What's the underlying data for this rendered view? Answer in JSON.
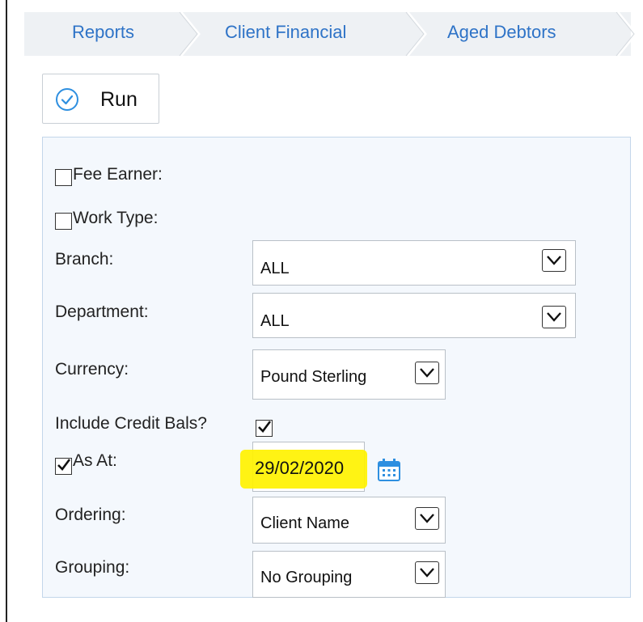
{
  "breadcrumb": {
    "items": [
      "Reports",
      "Client Financial",
      "Aged Debtors"
    ]
  },
  "toolbar": {
    "run_label": "Run"
  },
  "form": {
    "fee_earner": {
      "label": "Fee Earner:",
      "checked": false
    },
    "work_type": {
      "label": "Work Type:",
      "checked": false
    },
    "branch": {
      "label": "Branch:",
      "value": "ALL"
    },
    "department": {
      "label": "Department:",
      "value": "ALL"
    },
    "currency": {
      "label": "Currency:",
      "value": "Pound Sterling"
    },
    "include_credit": {
      "label": "Include Credit Bals?",
      "checked": true
    },
    "as_at": {
      "label": "As At:",
      "checked": true,
      "value": "29/02/2020"
    },
    "ordering": {
      "label": "Ordering:",
      "value": "Client Name"
    },
    "grouping": {
      "label": "Grouping:",
      "value": "No Grouping"
    }
  },
  "colors": {
    "accent": "#2e73c7",
    "highlight": "#fff200",
    "panel_bg": "#f4f8fd"
  },
  "icons": [
    "check-circle-icon",
    "chevron-down-icon",
    "calendar-icon",
    "checkmark-icon"
  ]
}
